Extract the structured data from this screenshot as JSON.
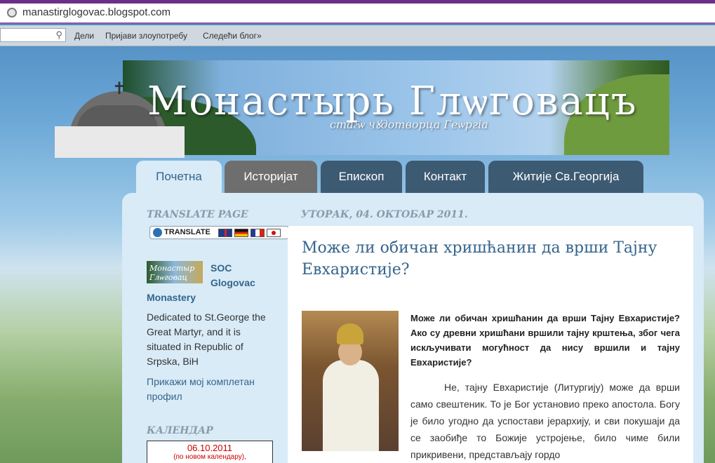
{
  "browser": {
    "url": "manastirglogovac.blogspot.com"
  },
  "navbar": {
    "share": "Дели",
    "report_abuse": "Пријави злоупотребу",
    "next_blog": "Следећи блог»"
  },
  "header": {
    "title": "Монастырь Глѡговацъ",
    "subtitle": "стаг҃ѡ чꙋдотворца Геѡргіа"
  },
  "tabs": [
    {
      "label": "Почетна",
      "active": true
    },
    {
      "label": "Историјат",
      "active": false
    },
    {
      "label": "Епископ",
      "active": false
    },
    {
      "label": "Контакт",
      "active": false
    },
    {
      "label": "Житије Св.Георгија",
      "active": false
    }
  ],
  "sidebar": {
    "translate_heading": "TRANSLATE PAGE",
    "translate_label": "TRANSLATE",
    "profile": {
      "image_text": "Монастыр Глѡговац",
      "name_line1": "SOC",
      "name_line2": "Glogovac",
      "name_line3": "Monastery",
      "description": "Dedicated to St.George the Great Martyr, and it is situated in Republic of Srpska, BiH",
      "link": "Прикажи мој комплетан профил"
    },
    "calendar_heading": "КАЛЕНДАР",
    "calendar": {
      "date": "06.10.2011",
      "note": "(по новом календару),"
    }
  },
  "post": {
    "date": "УТОРАК, 04. ОКТОБАР 2011.",
    "title": "Може ли обичан хришћанин да врши Тајну Евхаристије?",
    "lead": "Може ли обичан хришћанин да врши Тајну Евхаристије? Ако су древни хришћани вршили тајну крштења, због чега искључивати могућност да нису вршили и тајну Евхаристије?",
    "body": "Не, тајну Евхаристије (Литургију) може да врши само свештеник. То је Бог установио преко апостола. Богу је било угодно да успостави јерархију, и сви покушаји да се заобиђе то Божије устројење, било чиме били прикривени, представљају гордо"
  },
  "colors": {
    "accent": "#35648c",
    "tab_dark": "#3d5a73",
    "tab_active": "#d8ebf7",
    "browser_frame": "#6b2f8a"
  }
}
